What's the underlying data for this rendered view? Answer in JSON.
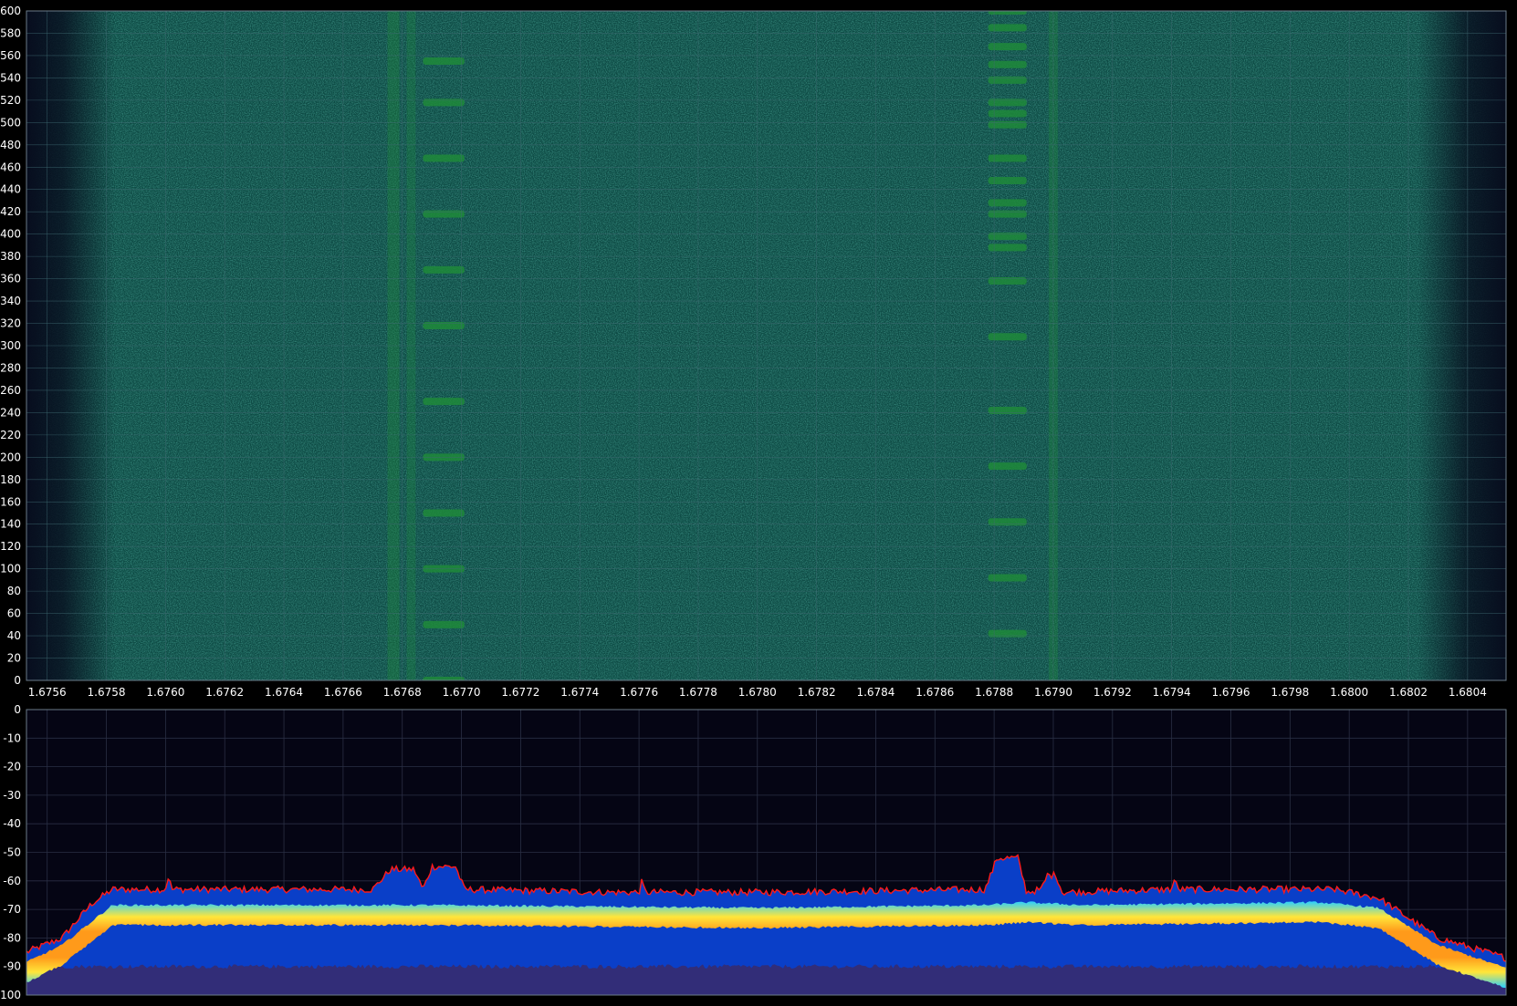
{
  "chart_data": [
    {
      "type": "heatmap",
      "title": "",
      "xlabel": "",
      "ylabel": "",
      "x_ticks": [
        "1.6756",
        "1.6758",
        "1.6760",
        "1.6762",
        "1.6764",
        "1.6766",
        "1.6768",
        "1.6770",
        "1.6772",
        "1.6774",
        "1.6776",
        "1.6778",
        "1.6780",
        "1.6782",
        "1.6784",
        "1.6786",
        "1.6788",
        "1.6790",
        "1.6792",
        "1.6794",
        "1.6796",
        "1.6798",
        "1.6800",
        "1.6802",
        "1.6804"
      ],
      "y_ticks": [
        "0",
        "20",
        "40",
        "60",
        "80",
        "100",
        "120",
        "140",
        "160",
        "180",
        "200",
        "220",
        "240",
        "260",
        "280",
        "300",
        "320",
        "340",
        "360",
        "380",
        "400",
        "420",
        "440",
        "460",
        "480",
        "500",
        "520",
        "540",
        "560",
        "580",
        "600"
      ],
      "xlim": [
        1.67553,
        1.68053
      ],
      "ylim": [
        0,
        600
      ],
      "grid": true,
      "colors": {
        "background": "#0a1a2a",
        "noise_floor": "#0f5a4a",
        "signal": "#1f8a3a"
      },
      "continuous_signals": [
        {
          "freq": 1.67677,
          "width": 4e-05,
          "intensity": 0.35
        },
        {
          "freq": 1.67683,
          "width": 3e-05,
          "intensity": 0.3
        },
        {
          "freq": 1.679,
          "width": 3e-05,
          "intensity": 0.35
        }
      ],
      "bursts": [
        {
          "freq_start": 1.67687,
          "freq_end": 1.67701,
          "times": [
            0,
            50,
            100,
            150,
            200,
            250,
            318,
            368,
            418,
            468,
            518,
            555
          ]
        },
        {
          "freq_start": 1.67878,
          "freq_end": 1.67891,
          "times": [
            42,
            92,
            142,
            192,
            242,
            308,
            358,
            388,
            398,
            418,
            428,
            448,
            468,
            498,
            508,
            518,
            538,
            552,
            568,
            585,
            600
          ]
        }
      ]
    },
    {
      "type": "area",
      "title": "",
      "xlabel": "",
      "ylabel": "",
      "x_ticks": [
        "1.6756",
        "1.6758",
        "1.6760",
        "1.6762",
        "1.6764",
        "1.6766",
        "1.6768",
        "1.6770",
        "1.6772",
        "1.6774",
        "1.6776",
        "1.6778",
        "1.6780",
        "1.6782",
        "1.6784",
        "1.6786",
        "1.6788",
        "1.6790",
        "1.6792",
        "1.6794",
        "1.6796",
        "1.6798",
        "1.6800",
        "1.6802",
        "1.6804"
      ],
      "y_ticks": [
        "0",
        "-10",
        "-20",
        "-30",
        "-40",
        "-50",
        "-60",
        "-70",
        "-80",
        "-90",
        "-100"
      ],
      "xlim": [
        1.67553,
        1.68053
      ],
      "ylim": [
        -100,
        0
      ],
      "grid": true,
      "colors": {
        "background": "#050514",
        "peak_hold": "#ff1a1a",
        "body": "#0a3fc8",
        "band": "#ff9a1a",
        "band_edge": "#ffe63a",
        "floor": "#3a2a6a"
      },
      "peak_envelope": {
        "x": [
          1.67553,
          1.67565,
          1.67575,
          1.67582,
          1.676,
          1.67601,
          1.67602,
          1.6767,
          1.67676,
          1.67684,
          1.67687,
          1.6769,
          1.67698,
          1.67701,
          1.6775,
          1.6776,
          1.67761,
          1.67762,
          1.678,
          1.67877,
          1.67881,
          1.67888,
          1.67891,
          1.67896,
          1.67898,
          1.67901,
          1.67903,
          1.6794,
          1.67941,
          1.67942,
          1.67965,
          1.67995,
          1.6801,
          1.6803,
          1.68053
        ],
        "y": [
          -85,
          -80,
          -68,
          -63,
          -63,
          -58,
          -63,
          -63,
          -56,
          -56,
          -63,
          -55,
          -55,
          -63,
          -64,
          -64,
          -60,
          -64,
          -64,
          -63,
          -52,
          -52,
          -64,
          -63,
          -58,
          -58,
          -64,
          -63,
          -59,
          -63,
          -63,
          -63,
          -66,
          -80,
          -87
        ]
      },
      "band_center": {
        "x": [
          1.67553,
          1.67565,
          1.67582,
          1.6767,
          1.6769,
          1.678,
          1.67877,
          1.67891,
          1.6791,
          1.6799,
          1.6801,
          1.6803,
          1.68053
        ],
        "y": [
          -92,
          -86,
          -72,
          -72,
          -72,
          -73,
          -72,
          -71,
          -72,
          -71,
          -73,
          -86,
          -94
        ]
      },
      "floor_level": -90
    }
  ]
}
